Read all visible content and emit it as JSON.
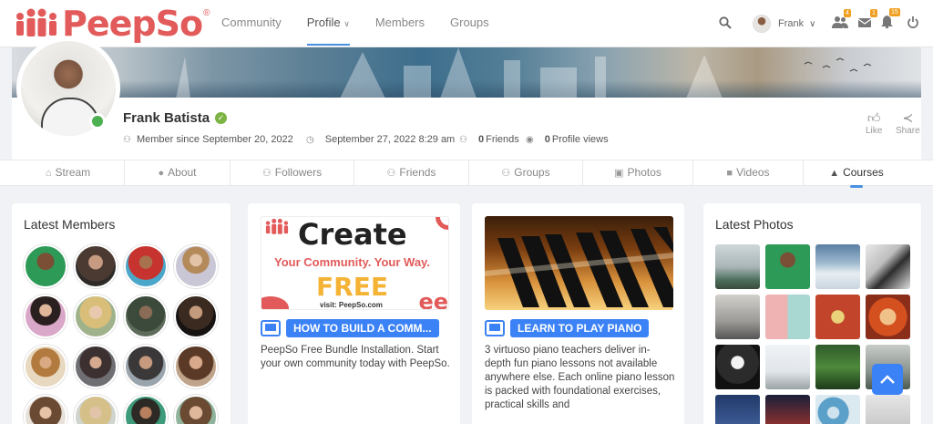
{
  "app": {
    "logo_text": "PeepSo",
    "logo_reg": "®"
  },
  "nav": {
    "links": [
      "Community",
      "Profile",
      "Members",
      "Groups"
    ],
    "user_name": "Frank",
    "badges": {
      "friends": "4",
      "messages": "1",
      "notifications": "15"
    },
    "colors": {
      "badge": "#f0a020",
      "accent": "#4a90e2"
    }
  },
  "profile": {
    "name": "Frank Batista",
    "member_since": "Member since September 20, 2022",
    "last_seen": "September 27, 2022 8:29 am",
    "friends_count": "0",
    "friends_label": "Friends",
    "views_count": "0",
    "views_label": "Profile views",
    "like_label": "Like",
    "share_label": "Share"
  },
  "tabs": [
    {
      "label": "Stream",
      "icon": "home-icon"
    },
    {
      "label": "About",
      "icon": "user-circle-icon"
    },
    {
      "label": "Followers",
      "icon": "user-check-icon"
    },
    {
      "label": "Friends",
      "icon": "users-icon"
    },
    {
      "label": "Groups",
      "icon": "groups-icon"
    },
    {
      "label": "Photos",
      "icon": "camera-icon"
    },
    {
      "label": "Videos",
      "icon": "video-icon"
    },
    {
      "label": "Courses",
      "icon": "graduation-cap-icon"
    }
  ],
  "latest_members": {
    "title": "Latest Members"
  },
  "courses": [
    {
      "image_title": "Create",
      "image_subtitle": "Your Community. Your Way.",
      "image_free": "FREE",
      "image_url_text": "visit: PeepSo.com",
      "tag": "HOW TO BUILD A COMM...",
      "description": "PeepSo Free Bundle Installation. Start your own community today with PeepSo."
    },
    {
      "tag": "LEARN TO PLAY PIANO",
      "description": "3 virtuoso piano teachers deliver in-depth fun piano lessons not available anywhere else. Each online piano lesson is packed with foundational exercises, practical skills and"
    }
  ],
  "latest_photos": {
    "title": "Latest Photos"
  }
}
